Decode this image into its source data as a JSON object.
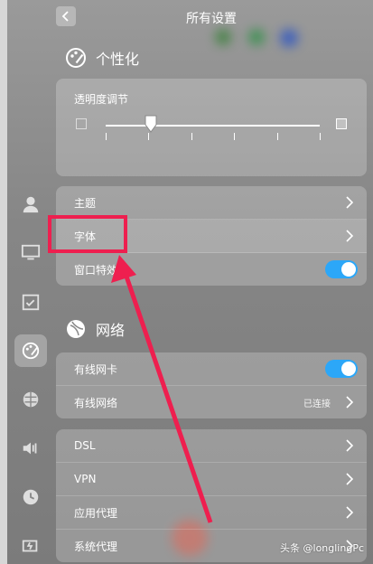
{
  "header": {
    "title": "所有设置"
  },
  "personalization": {
    "section_title": "个性化",
    "transparency_label": "透明度调节",
    "transparency_level": 0.21,
    "rows": [
      {
        "label": "主题"
      },
      {
        "label": "字体"
      },
      {
        "label": "窗口特效",
        "toggle": true
      }
    ]
  },
  "network": {
    "section_title": "网络",
    "rows": [
      {
        "label": "有线网卡",
        "toggle": true
      },
      {
        "label": "有线网络",
        "status": "已连接"
      }
    ]
  },
  "proxy_rows": [
    {
      "label": "DSL"
    },
    {
      "label": "VPN"
    },
    {
      "label": "应用代理"
    },
    {
      "label": "系统代理"
    }
  ],
  "watermark": "头条 @longlingPc",
  "colors": {
    "accent": "#2ca7f8",
    "highlight": "#ee1f4f"
  },
  "rail_icons": [
    "avatar-icon",
    "display-icon",
    "calendar-icon",
    "personalization-icon",
    "network-icon",
    "sound-icon",
    "clock-icon",
    "power-icon"
  ]
}
